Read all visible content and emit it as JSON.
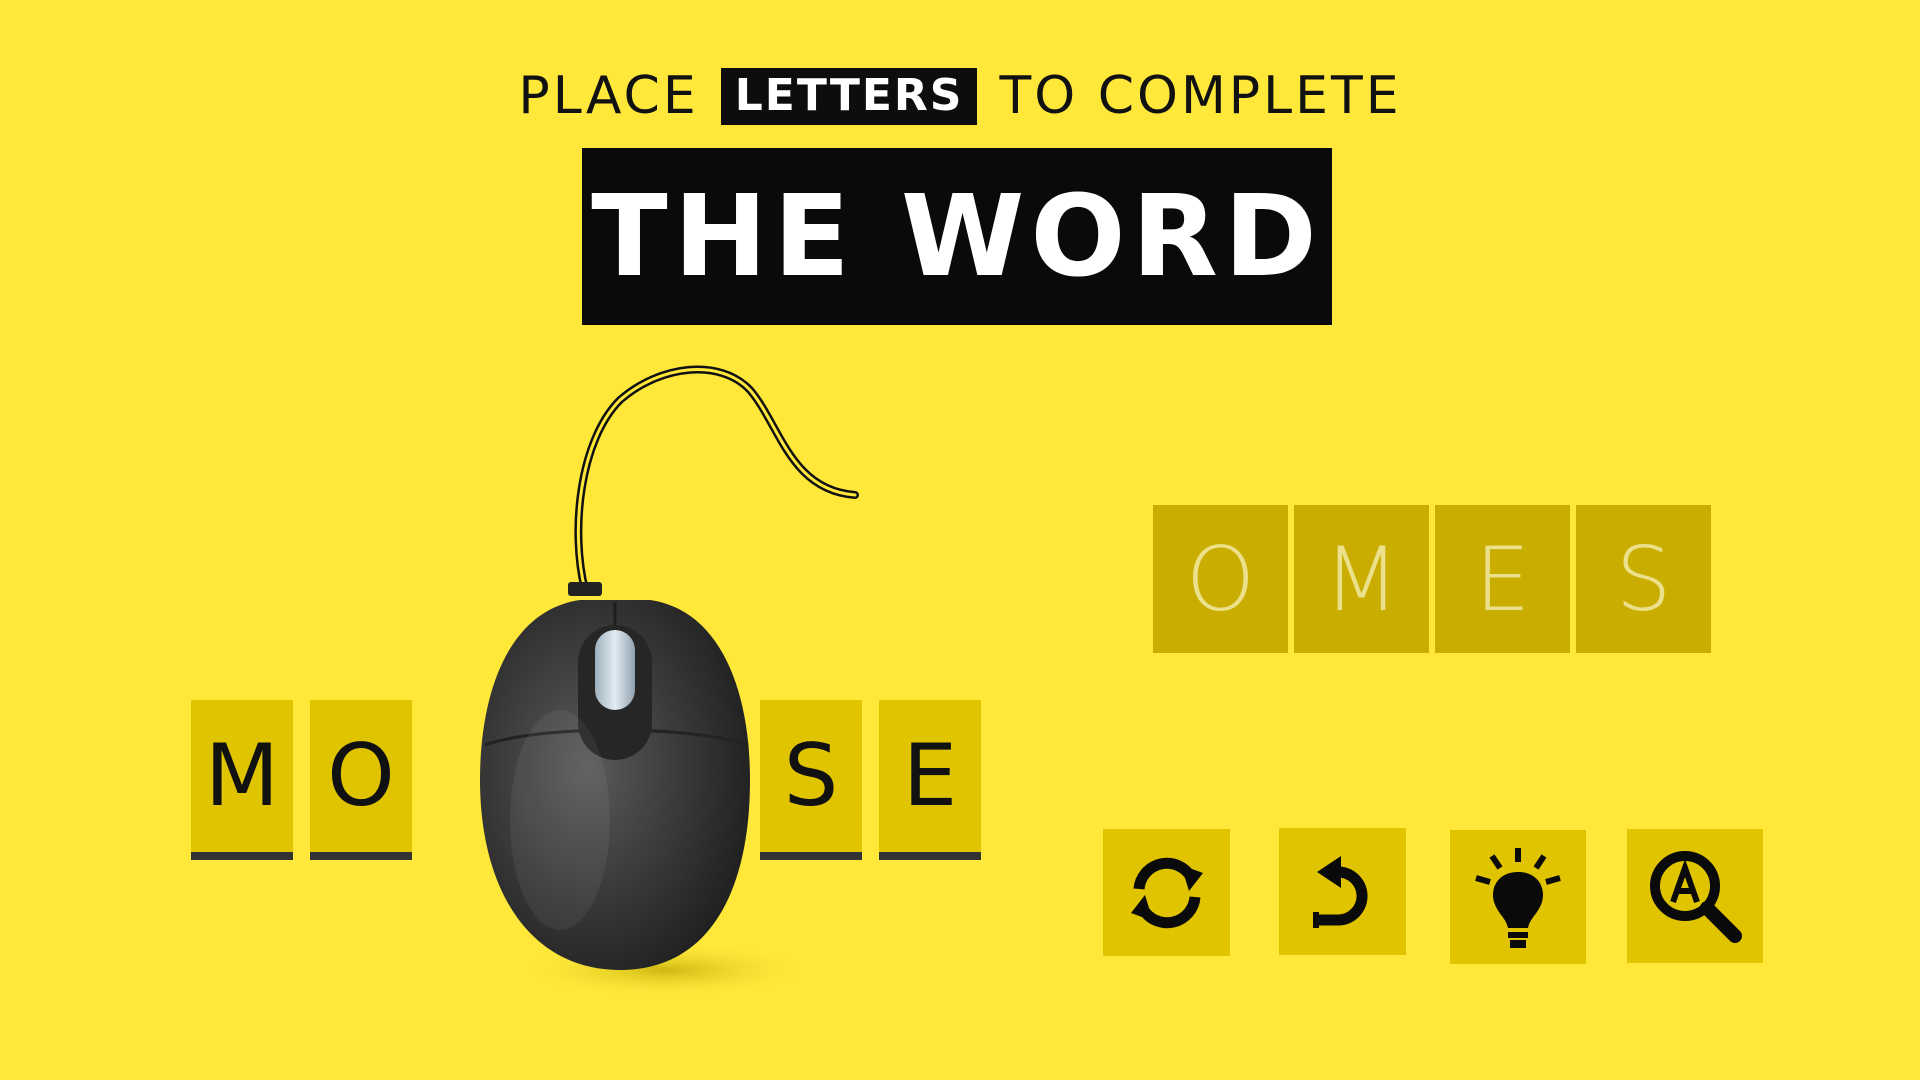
{
  "header": {
    "line_before": "PLACE",
    "highlight": "LETTERS",
    "line_after": "TO COMPLETE",
    "title": "THE WORD"
  },
  "puzzle": {
    "slots": [
      {
        "letter": "M"
      },
      {
        "letter": "O"
      },
      {
        "letter": ""
      },
      {
        "letter": "S"
      },
      {
        "letter": "E"
      }
    ],
    "tiles": [
      "O",
      "M",
      "E",
      "S"
    ]
  },
  "actions": [
    {
      "icon": "shuffle-icon"
    },
    {
      "icon": "undo-icon"
    },
    {
      "icon": "hint-lightbulb-icon"
    },
    {
      "icon": "reveal-letter-icon"
    }
  ],
  "colors": {
    "background": "#ffe83a",
    "slot": "#e0c400",
    "tile": "#c9ad00",
    "dark": "#0a0a0a"
  }
}
